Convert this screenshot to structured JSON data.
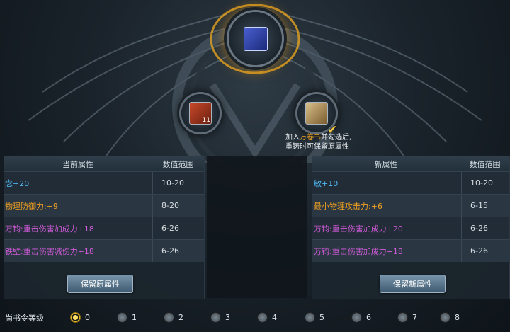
{
  "forge": {
    "top_slot_icon": "blue-scroll-item-icon",
    "left_slot_icon": "red-armor-item-icon",
    "left_slot_count": "11",
    "right_slot_icon": "scroll-item-icon",
    "hint_prefix": "加入",
    "hint_item": "万卷书",
    "hint_suffix": "并勾选后,",
    "hint_line2": "重铸时可保留原属性"
  },
  "current_panel": {
    "col_attr": "当前属性",
    "col_range": "数值范围",
    "rows": [
      {
        "attr": "念+20",
        "range": "10-20",
        "color": "#4fb6f0"
      },
      {
        "attr": "物理防御力:+9",
        "range": "8-20",
        "color": "#f0a020"
      },
      {
        "attr": "万钧:重击伤害加成力+18",
        "range": "6-26",
        "color": "#d05ad8"
      },
      {
        "attr": "铁壁:重击伤害减伤力+18",
        "range": "6-26",
        "color": "#d05ad8"
      }
    ],
    "button": "保留原属性"
  },
  "new_panel": {
    "col_attr": "新属性",
    "col_range": "数值范围",
    "rows": [
      {
        "attr": "敏+10",
        "range": "10-20",
        "color": "#4fb6f0"
      },
      {
        "attr": "最小物理攻击力:+6",
        "range": "6-15",
        "color": "#f0a020"
      },
      {
        "attr": "万钧:重击伤害加成力+20",
        "range": "6-26",
        "color": "#d05ad8"
      },
      {
        "attr": "万钧:重击伤害加成力+18",
        "range": "6-26",
        "color": "#d05ad8"
      }
    ],
    "button": "保留新属性"
  },
  "levels": {
    "label": "尚书令等级",
    "selected": "0",
    "options": [
      "0",
      "1",
      "2",
      "3",
      "4",
      "5",
      "6",
      "7",
      "8"
    ]
  }
}
